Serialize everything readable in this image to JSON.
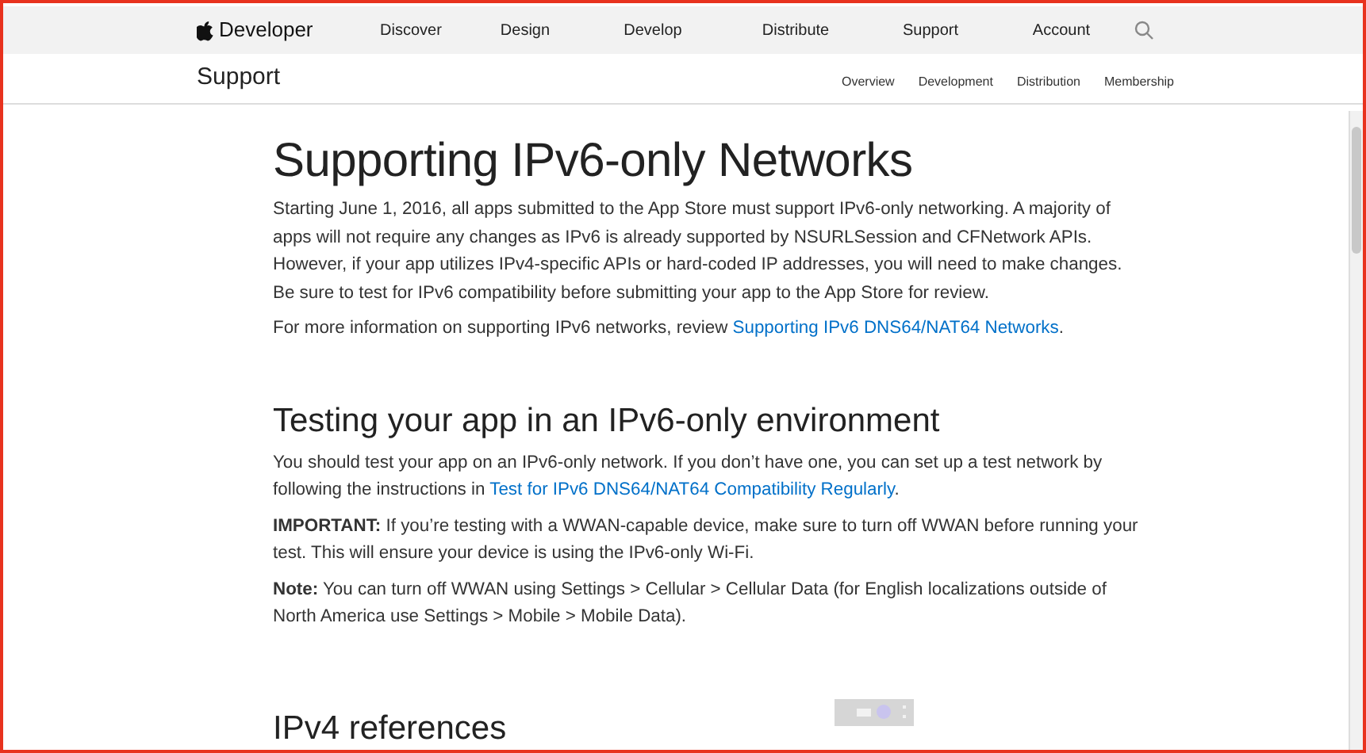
{
  "global_nav": {
    "brand": "Developer",
    "items": [
      "Discover",
      "Design",
      "Develop",
      "Distribute",
      "Support",
      "Account"
    ]
  },
  "local_nav": {
    "title": "Support",
    "items": [
      "Overview",
      "Development",
      "Distribution",
      "Membership"
    ]
  },
  "article": {
    "title": "Supporting IPv6-only Networks",
    "sections": [
      {
        "paragraphs": [
          {
            "text": "Starting June 1, 2016, all apps submitted to the App Store must support IPv6-only networking. A majority of apps will not require any changes as IPv6 is already supported by NSURLSession and CFNetwork APIs. However, if your app utilizes IPv4-specific APIs or hard-coded IP addresses, you will need to make changes. Be sure to test for IPv6 compatibility before submitting your app to the App Store for review."
          },
          {
            "text": "For more information on supporting IPv6 networks, review ",
            "link": "Supporting IPv6 DNS64/NAT64 Networks",
            "after": "."
          }
        ]
      },
      {
        "heading": "Testing your app in an IPv6-only environment",
        "paragraphs": [
          {
            "text": "You should test your app on an IPv6-only network. If you don’t have one, you can set up a test network by following the instructions in ",
            "link": "Test for IPv6 DNS64/NAT64 Compatibility Regularly",
            "after": "."
          },
          {
            "text": "**IMPORTANT:** If you’re testing with a WWAN-capable device, make sure to turn off WWAN before running your test. This will ensure your device is using the IPv6-only Wi-Fi."
          },
          {
            "text": "**Note:** You can turn off WWAN using Settings > Cellular > Cellular Data (for English localizations outside of North America use Settings > Mobile > Mobile Data)."
          }
        ]
      },
      {
        "heading": "IPv4 references"
      }
    ]
  }
}
